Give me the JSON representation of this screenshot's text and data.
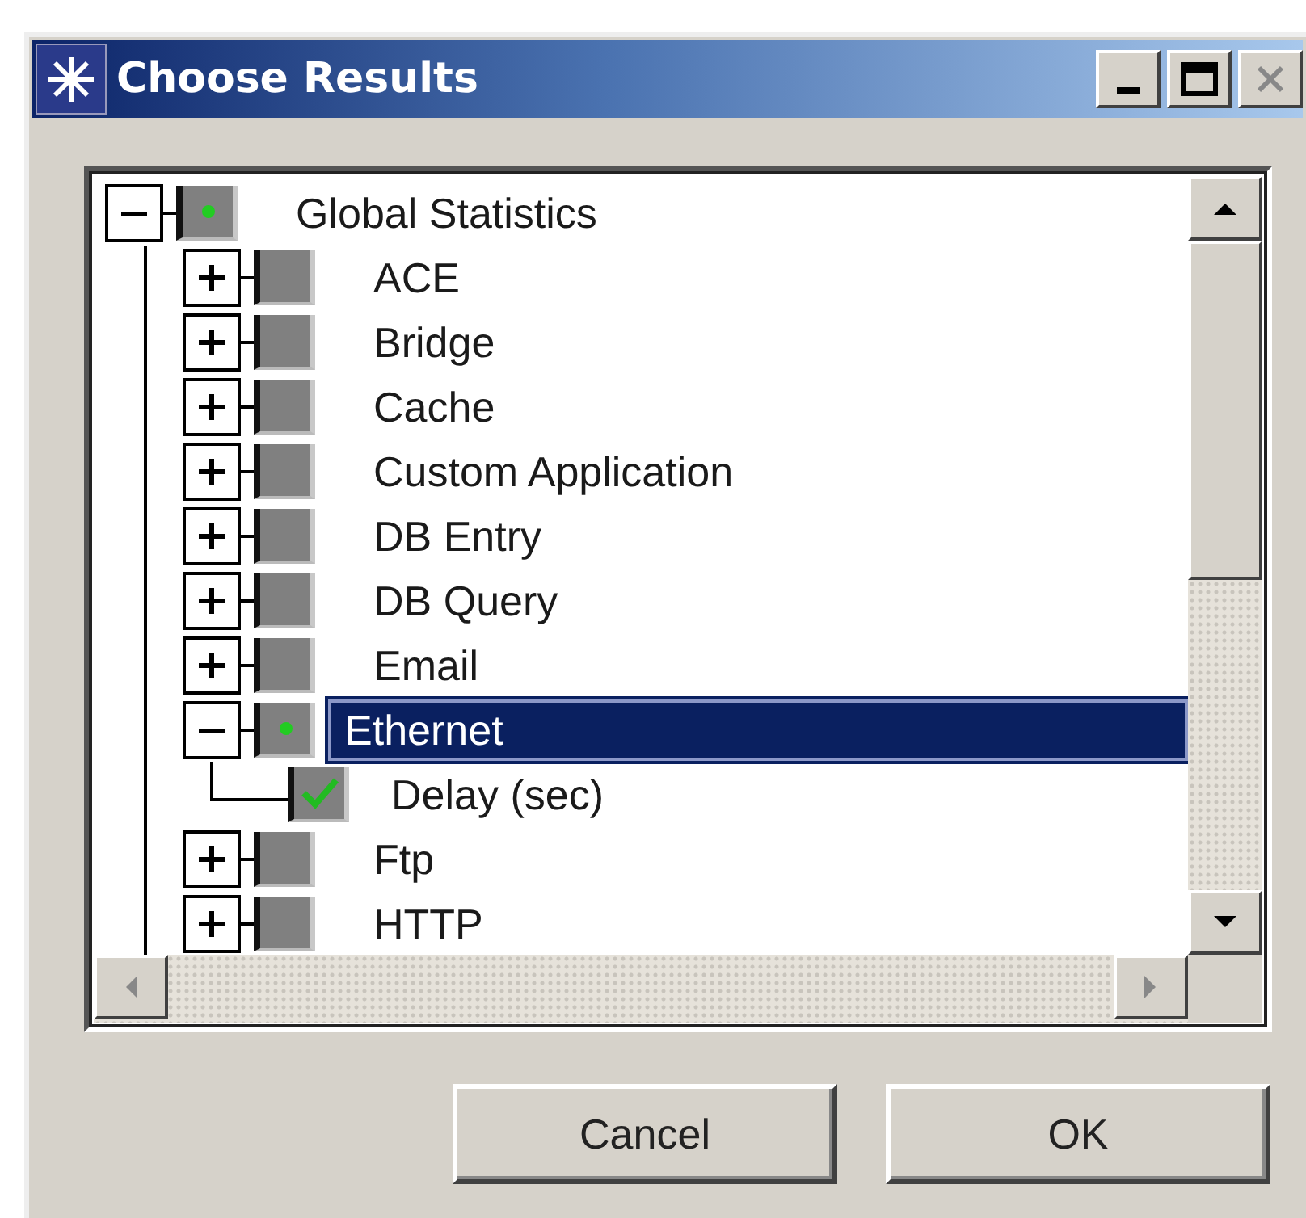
{
  "window": {
    "title": "Choose Results"
  },
  "tree": [
    {
      "label": "Global Statistics",
      "expanded": true,
      "partial": true,
      "selected": false,
      "children": [
        {
          "label": "ACE",
          "expanded": false,
          "partial": false,
          "selected": false
        },
        {
          "label": "Bridge",
          "expanded": false,
          "partial": false,
          "selected": false
        },
        {
          "label": "Cache",
          "expanded": false,
          "partial": false,
          "selected": false
        },
        {
          "label": "Custom Application",
          "expanded": false,
          "partial": false,
          "selected": false
        },
        {
          "label": "DB Entry",
          "expanded": false,
          "partial": false,
          "selected": false
        },
        {
          "label": "DB Query",
          "expanded": false,
          "partial": false,
          "selected": false
        },
        {
          "label": "Email",
          "expanded": false,
          "partial": false,
          "selected": false
        },
        {
          "label": "Ethernet",
          "expanded": true,
          "partial": true,
          "selected": true,
          "children": [
            {
              "kind": "statistic",
              "label": "Delay (sec)",
              "checked": true,
              "selected": false
            }
          ]
        },
        {
          "label": "Ftp",
          "expanded": false,
          "partial": false,
          "selected": false
        },
        {
          "label": "HTTP",
          "expanded": false,
          "partial": false,
          "selected": false
        }
      ]
    }
  ],
  "buttons": [
    {
      "label": "Cancel"
    },
    {
      "label": "OK"
    }
  ]
}
